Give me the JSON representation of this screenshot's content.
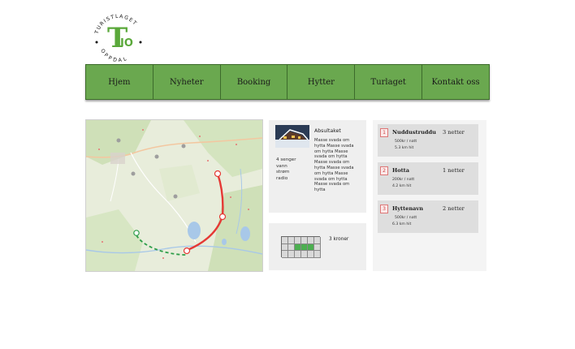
{
  "logo": {
    "arc_text": "TURISTLAGET",
    "bottom_text": "OPPDAL",
    "letter": "T",
    "sub": "IO",
    "color": "#5aa83a"
  },
  "nav": {
    "items": [
      {
        "label": "Hjem"
      },
      {
        "label": "Nyheter"
      },
      {
        "label": "Booking"
      },
      {
        "label": "Hytter"
      },
      {
        "label": "Turlaget"
      },
      {
        "label": "Kontakt oss"
      }
    ],
    "color": "#6aa84f"
  },
  "map": {
    "route_color": "#e53935",
    "trail_color": "#2e9e4a"
  },
  "cabin": {
    "title": "Absultaket",
    "description": "Masse svada om hytta Masse svada om hytta Masse svada om hytta Masse svada om hytta Masse svada om hytta Masse svada om hytta Masse svada om hytta",
    "amenities": [
      "4 senger",
      "vann",
      "strøm",
      "radio"
    ]
  },
  "calendar": {
    "price": "3 kroner",
    "highlight_color": "#4caf50"
  },
  "listings": [
    {
      "num": "1",
      "name": "Nuddustruddu",
      "nights": "3 netter",
      "price": "500kr / natt",
      "distance": "5.3 km hit"
    },
    {
      "num": "2",
      "name": "Hotta",
      "nights": "1 netter",
      "price": "200kr / natt",
      "distance": "4.2 km hit"
    },
    {
      "num": "3",
      "name": "Hyttenavn",
      "nights": "2 netter",
      "price": "500kr / natt",
      "distance": "6.3 km hit"
    }
  ]
}
